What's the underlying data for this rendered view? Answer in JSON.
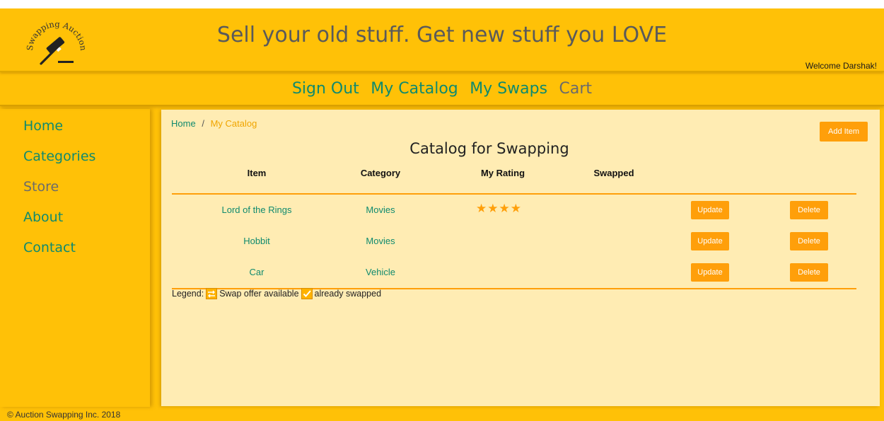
{
  "header": {
    "logo_text": "Swapping Auction",
    "title": "Sell your old stuff. Get new stuff you LOVE",
    "welcome": "Welcome Darshak!"
  },
  "nav": {
    "items": [
      {
        "label": "Sign Out",
        "active": true
      },
      {
        "label": "My Catalog",
        "active": true
      },
      {
        "label": "My Swaps",
        "active": true
      },
      {
        "label": "Cart",
        "active": false
      }
    ]
  },
  "sidebar": {
    "items": [
      {
        "label": "Home",
        "active": true
      },
      {
        "label": "Categories",
        "active": true
      },
      {
        "label": "Store",
        "active": false
      },
      {
        "label": "About",
        "active": true
      },
      {
        "label": "Contact",
        "active": true
      }
    ]
  },
  "main": {
    "breadcrumb": {
      "home": "Home",
      "separator": "/",
      "current": "My Catalog"
    },
    "add_button": "Add Item",
    "title": "Catalog for Swapping",
    "columns": [
      "Item",
      "Category",
      "My Rating",
      "Swapped"
    ],
    "rows": [
      {
        "item": "Lord of the Rings",
        "category": "Movies",
        "rating": 4,
        "rating_text": "★★★★",
        "update": "Update",
        "delete": "Delete"
      },
      {
        "item": "Hobbit",
        "category": "Movies",
        "rating": 0,
        "rating_text": "",
        "update": "Update",
        "delete": "Delete"
      },
      {
        "item": "Car",
        "category": "Vehicle",
        "rating": 0,
        "rating_text": "",
        "update": "Update",
        "delete": "Delete"
      }
    ],
    "legend": {
      "label": "Legend:",
      "swap_icon": "swap-arrows-icon",
      "swap_text": "Swap offer available",
      "check_icon": "checkbox-check-icon",
      "check_text": "already swapped"
    }
  },
  "footer": {
    "text": "© Auction Swapping Inc. 2018"
  },
  "colors": {
    "page_bg": "#ffc107",
    "content_bg": "#ffecb3",
    "link": "#0f8a6e",
    "button": "#ff9f0a",
    "accent_line": "#ff9f0a"
  }
}
